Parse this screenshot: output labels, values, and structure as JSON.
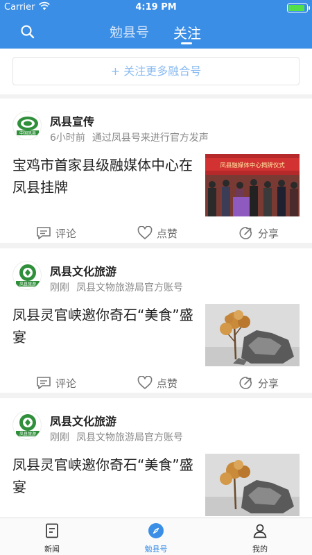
{
  "status_bar": {
    "carrier": "Carrier",
    "time": "4:19 PM"
  },
  "nav": {
    "tabs": [
      "勉县号",
      "关注"
    ],
    "active_tab": "关注"
  },
  "follow_more": {
    "label": "+ 关注更多融合号"
  },
  "feed": [
    {
      "account": "凤县宣传",
      "time": "6小时前",
      "desc": "通过凤县号来进行官方发声",
      "title": "宝鸡市首家县级融媒体中心在凤县挂牌",
      "thumb_banner": "凤县融媒体中心揭牌仪式",
      "logo_text": "中国凤县",
      "actions": {
        "comment": "评论",
        "like": "点赞",
        "share": "分享"
      }
    },
    {
      "account": "凤县文化旅游",
      "time": "刚刚",
      "desc": "凤县文物旅游局官方账号",
      "title": "凤县灵官峡邀你奇石“美食”盛宴",
      "logo_text": "凤县旅游",
      "actions": {
        "comment": "评论",
        "like": "点赞",
        "share": "分享"
      }
    },
    {
      "account": "凤县文化旅游",
      "time": "刚刚",
      "desc": "凤县文物旅游局官方账号",
      "title": "凤县灵官峡邀你奇石“美食”盛宴",
      "logo_text": "凤县旅游"
    }
  ],
  "tab_bar": {
    "items": [
      "新闻",
      "勉县号",
      "我的"
    ],
    "active": "勉县号"
  },
  "colors": {
    "brand": "#3a8ee6",
    "follow_text": "#8cbcf0",
    "logo_green": "#2f8f3a"
  }
}
